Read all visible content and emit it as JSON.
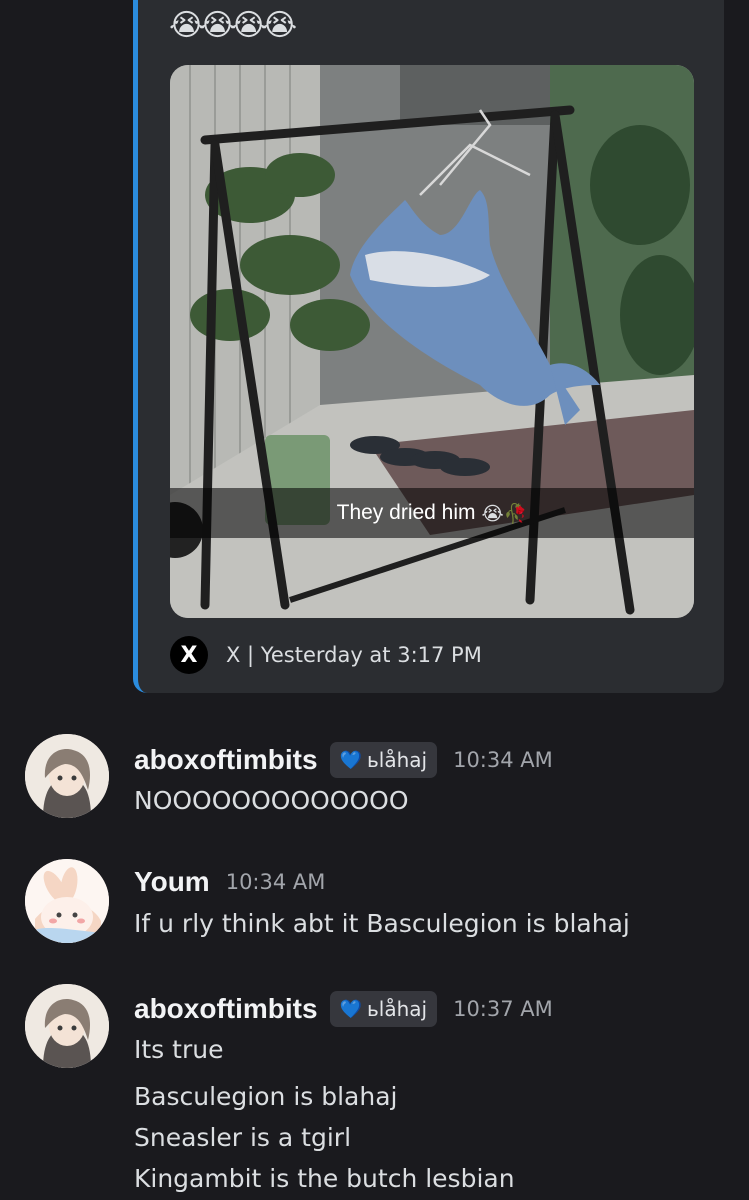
{
  "embed": {
    "emojis": "😭😭😭😭",
    "caption": "They dried him",
    "caption_emojis": "😭🥀",
    "source_label": "X | Yesterday at 3:17 PM",
    "x_logo": "X",
    "accent_color": "#2b8cde"
  },
  "messages": [
    {
      "username": "aboxoftimbits",
      "role_icon": "light-blue-heart-icon",
      "role_heart": "💙",
      "role": "ьlåhaj",
      "time": "10:34 AM",
      "lines": [
        "NOOOOOOOOOOOOO"
      ]
    },
    {
      "username": "Youm",
      "time": "10:34 AM",
      "lines": [
        "If u rly think abt it Basculegion is blahaj"
      ]
    },
    {
      "username": "aboxoftimbits",
      "role_icon": "light-blue-heart-icon",
      "role_heart": "💙",
      "role": "ьlåhaj",
      "time": "10:37 AM",
      "lines": [
        "Its true",
        "Basculegion is blahaj",
        "Sneasler is a tgirl",
        "Kingambit is the butch lesbian"
      ]
    }
  ]
}
